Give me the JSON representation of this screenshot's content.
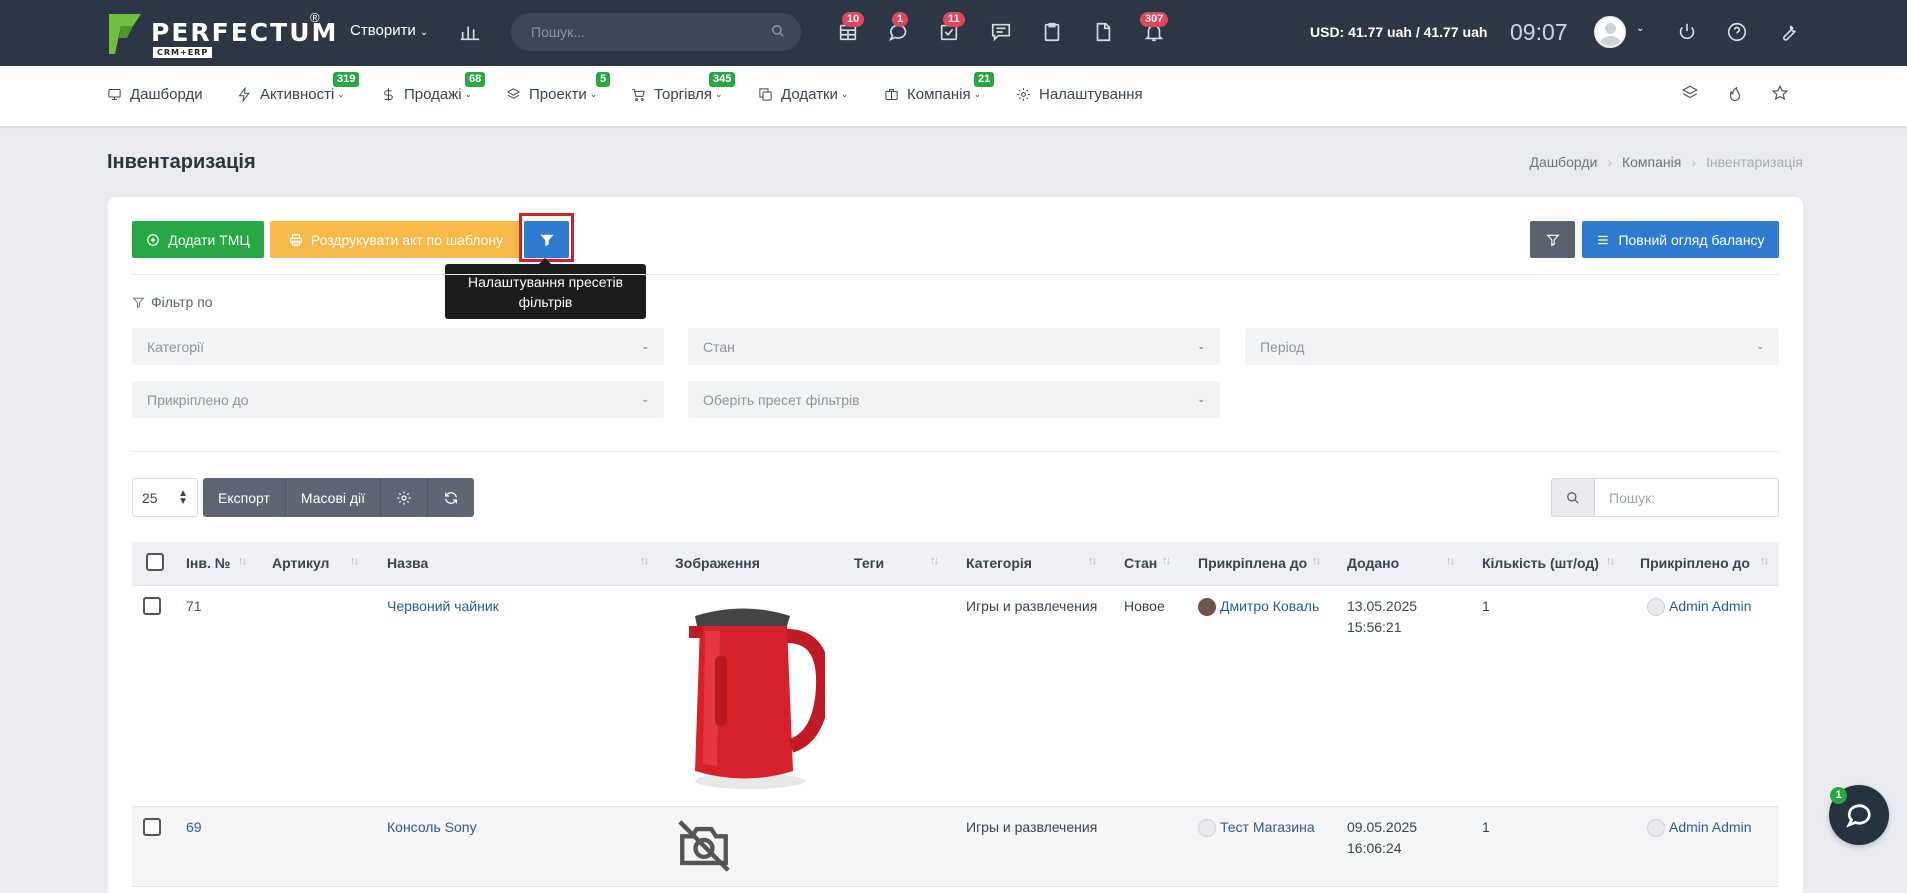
{
  "topbar": {
    "logo_text": "PERFECTUM",
    "logo_reg": "®",
    "logo_sub": "CRM+ERP",
    "create_label": "Створити",
    "search_placeholder": "Пошук...",
    "badges": {
      "tasks_board": "10",
      "chat": "1",
      "tasks": "11",
      "notifications": "307"
    },
    "currency": "USD: 41.77 uah / 41.77 uah",
    "time": "09:07"
  },
  "nav": {
    "items": [
      {
        "label": "Дашборди"
      },
      {
        "label": "Активності",
        "badge": "319"
      },
      {
        "label": "Продажі",
        "badge": "68"
      },
      {
        "label": "Проекти",
        "badge": "5"
      },
      {
        "label": "Торгівля",
        "badge": "345"
      },
      {
        "label": "Додатки"
      },
      {
        "label": "Компанія",
        "badge": "21"
      },
      {
        "label": "Налаштування"
      }
    ]
  },
  "page": {
    "title": "Інвентаризація",
    "breadcrumb": [
      "Дашборди",
      "Компанія",
      "Інвентаризація"
    ]
  },
  "toolbar": {
    "add_label": "Додати ТМЦ",
    "print_label": "Роздрукувати акт по шаблону",
    "tooltip": "Налаштування пресетів фільтрів",
    "balance_label": "Повний огляд балансу"
  },
  "filters": {
    "label": "Фільтр по",
    "categories": "Категорії",
    "state": "Стан",
    "period": "Період",
    "attached_to": "Прикріплено до",
    "preset": "Оберіть пресет фільтрів"
  },
  "table_tools": {
    "per_page": "25",
    "export": "Експорт",
    "mass_actions": "Масові дії",
    "search_placeholder": "Пошук:"
  },
  "table": {
    "columns": [
      "Інв. №",
      "Артикул",
      "Назва",
      "Зображення",
      "Теги",
      "Категорія",
      "Стан",
      "Прикріплена до",
      "Додано",
      "Кількість (шт/од)",
      "Прикріплено до"
    ],
    "rows": [
      {
        "inv": "71",
        "article": "",
        "name": "Червоний чайник",
        "tags": "",
        "category": "Игры и развлечения",
        "state": "Новое",
        "assigned": "Дмитро Коваль",
        "date": "13.05.2025",
        "time": "15:56:21",
        "qty": "1",
        "attached": "Admin Admin"
      },
      {
        "inv": "69",
        "article": "",
        "name": "Консоль Sony",
        "tags": "",
        "category": "Игры и развлечения",
        "state": "",
        "assigned": "Тест Магазина",
        "date": "09.05.2025",
        "time": "16:06:24",
        "qty": "1",
        "attached": "Admin Admin"
      }
    ]
  },
  "chat": {
    "badge": "1"
  },
  "colors": {
    "topbar": "#2c3645",
    "green": "#28a745",
    "orange": "#f8b84a",
    "blue": "#2f7bd1",
    "badge_red": "#e4455a"
  }
}
